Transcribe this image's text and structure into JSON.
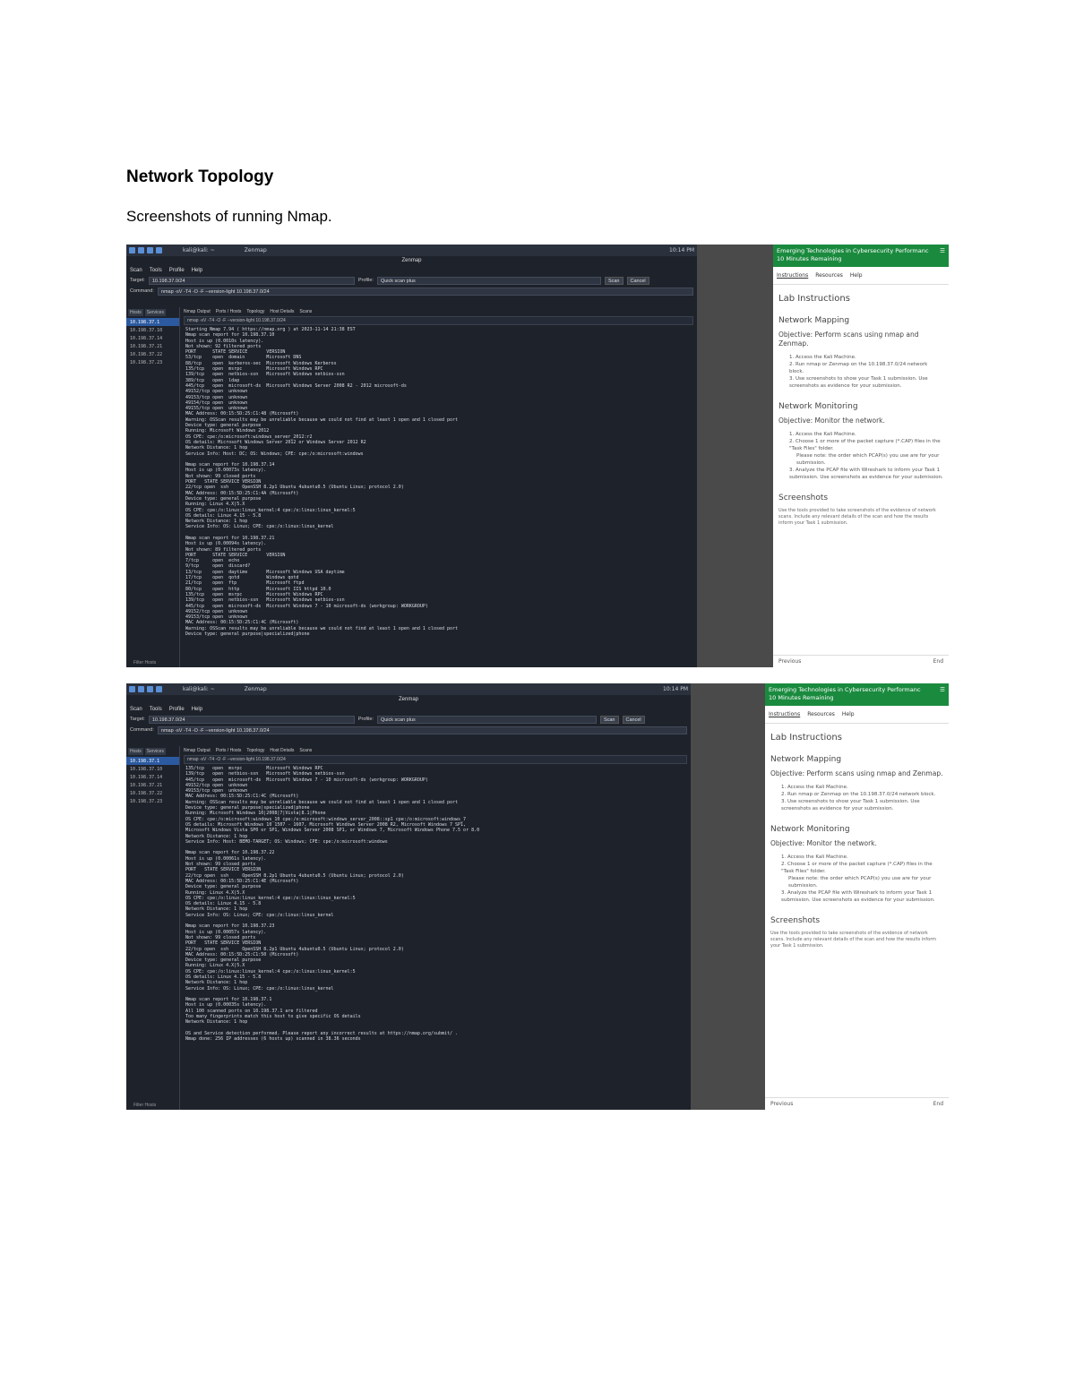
{
  "heading": "Network Topology",
  "caption": "Screenshots of running Nmap.",
  "screens": {
    "taskbar_win1": "kali@kali: ~",
    "taskbar_win2": "Zenmap",
    "clock": "10:14 PM",
    "window_title": "Zenmap",
    "menu": [
      "Scan",
      "Tools",
      "Profile",
      "Help"
    ],
    "target_label": "Target:",
    "target1": "10.198.37.0/24",
    "target2": "10.198.37.0/24",
    "profile_label": "Profile:",
    "profile_value": "Quick scan plus",
    "scan_btn": "Scan",
    "cancel_btn": "Cancel",
    "command_label": "Command:",
    "command": "nmap -sV -T4 -O -F --version-light 10.198.37.0/24",
    "host_tabs": [
      "Hosts",
      "Services"
    ],
    "out_tabs": [
      "Nmap Output",
      "Ports / Hosts",
      "Topology",
      "Host Details",
      "Scans"
    ],
    "out_selector": "nmap -sV -T4 -O -F --version-light 10.198.37.0/24",
    "details_btn": "Details",
    "filter": "Filter Hosts",
    "hosts1": [
      "10.198.37.1",
      "10.198.37.10",
      "10.198.37.14",
      "10.198.37.21",
      "10.198.37.22",
      "10.198.37.23"
    ],
    "hosts2": [
      "10.198.37.1",
      "10.198.37.10",
      "10.198.37.14",
      "10.198.37.21",
      "10.198.37.22",
      "10.198.37.23"
    ],
    "output1": "Starting Nmap 7.94 ( https://nmap.org ) at 2023-11-14 21:38 EST\nNmap scan report for 10.198.37.10\nHost is up (0.0010s latency).\nNot shown: 92 filtered ports\nPORT      STATE SERVICE       VERSION\n53/tcp    open  domain        Microsoft DNS\n88/tcp    open  kerberos-sec  Microsoft Windows Kerberos\n135/tcp   open  msrpc         Microsoft Windows RPC\n139/tcp   open  netbios-ssn   Microsoft Windows netbios-ssn\n389/tcp   open  ldap\n445/tcp   open  microsoft-ds  Microsoft Windows Server 2008 R2 - 2012 microsoft-ds\n49152/tcp open  unknown\n49153/tcp open  unknown\n49154/tcp open  unknown\n49155/tcp open  unknown\nMAC Address: 00:15:5D:25:C1:48 (Microsoft)\nWarning: OSScan results may be unreliable because we could not find at least 1 open and 1 closed port\nDevice type: general purpose\nRunning: Microsoft Windows 2012\nOS CPE: cpe:/o:microsoft:windows_server_2012:r2\nOS details: Microsoft Windows Server 2012 or Windows Server 2012 R2\nNetwork Distance: 1 hop\nService Info: Host: DC; OS: Windows; CPE: cpe:/o:microsoft:windows\n\nNmap scan report for 10.198.37.14\nHost is up (0.00073s latency).\nNot shown: 99 closed ports\nPORT   STATE SERVICE VERSION\n22/tcp open  ssh     OpenSSH 8.2p1 Ubuntu 4ubuntu0.5 (Ubuntu Linux; protocol 2.0)\nMAC Address: 00:15:5D:25:C1:4A (Microsoft)\nDevice type: general purpose\nRunning: Linux 4.X|5.X\nOS CPE: cpe:/o:linux:linux_kernel:4 cpe:/o:linux:linux_kernel:5\nOS details: Linux 4.15 - 5.8\nNetwork Distance: 1 hop\nService Info: OS: Linux; CPE: cpe:/o:linux:linux_kernel\n\nNmap scan report for 10.198.37.21\nHost is up (0.00094s latency).\nNot shown: 89 filtered ports\nPORT      STATE SERVICE       VERSION\n7/tcp     open  echo\n9/tcp     open  discard?\n13/tcp    open  daytime       Microsoft Windows USA daytime\n17/tcp    open  qotd          Windows qotd\n21/tcp    open  ftp           Microsoft ftpd\n80/tcp    open  http          Microsoft IIS httpd 10.0\n135/tcp   open  msrpc         Microsoft Windows RPC\n139/tcp   open  netbios-ssn   Microsoft Windows netbios-ssn\n445/tcp   open  microsoft-ds  Microsoft Windows 7 - 10 microsoft-ds (workgroup: WORKGROUP)\n49152/tcp open  unknown\n49153/tcp open  unknown\nMAC Address: 00:15:5D:25:C1:4C (Microsoft)\nWarning: OSScan results may be unreliable because we could not find at least 1 open and 1 closed port\nDevice type: general purpose|specialized|phone",
    "output2": "135/tcp   open  msrpc         Microsoft Windows RPC\n139/tcp   open  netbios-ssn   Microsoft Windows netbios-ssn\n445/tcp   open  microsoft-ds  Microsoft Windows 7 - 10 microsoft-ds (workgroup: WORKGROUP)\n49152/tcp open  unknown\n49153/tcp open  unknown\nMAC Address: 00:15:5D:25:C1:4C (Microsoft)\nWarning: OSScan results may be unreliable because we could not find at least 1 open and 1 closed port\nDevice type: general purpose|specialized|phone\nRunning: Microsoft Windows 10|2008|7|Vista|8.1|Phone\nOS CPE: cpe:/o:microsoft:windows_10 cpe:/o:microsoft:windows_server_2008::sp1 cpe:/o:microsoft:windows_7\nOS details: Microsoft Windows 10 1507 - 1607, Microsoft Windows Server 2008 R2, Microsoft Windows 7 SP1,\nMicrosoft Windows Vista SP0 or SP1, Windows Server 2008 SP1, or Windows 7, Microsoft Windows Phone 7.5 or 8.0\nNetwork Distance: 1 hop\nService Info: Host: BEMO-TARGET; OS: Windows; CPE: cpe:/o:microsoft:windows\n\nNmap scan report for 10.198.37.22\nHost is up (0.00061s latency).\nNot shown: 99 closed ports\nPORT   STATE SERVICE VERSION\n22/tcp open  ssh     OpenSSH 8.2p1 Ubuntu 4ubuntu0.5 (Ubuntu Linux; protocol 2.0)\nMAC Address: 00:15:5D:25:C1:4E (Microsoft)\nDevice type: general purpose\nRunning: Linux 4.X|5.X\nOS CPE: cpe:/o:linux:linux_kernel:4 cpe:/o:linux:linux_kernel:5\nOS details: Linux 4.15 - 5.8\nNetwork Distance: 1 hop\nService Info: OS: Linux; CPE: cpe:/o:linux:linux_kernel\n\nNmap scan report for 10.198.37.23\nHost is up (0.00057s latency).\nNot shown: 99 closed ports\nPORT   STATE SERVICE VERSION\n22/tcp open  ssh     OpenSSH 8.2p1 Ubuntu 4ubuntu0.5 (Ubuntu Linux; protocol 2.0)\nMAC Address: 00:15:5D:25:C1:50 (Microsoft)\nDevice type: general purpose\nRunning: Linux 4.X|5.X\nOS CPE: cpe:/o:linux:linux_kernel:4 cpe:/o:linux:linux_kernel:5\nOS details: Linux 4.15 - 5.8\nNetwork Distance: 1 hop\nService Info: OS: Linux; CPE: cpe:/o:linux:linux_kernel\n\nNmap scan report for 10.198.37.1\nHost is up (0.00035s latency).\nAll 100 scanned ports on 10.198.37.1 are filtered\nToo many fingerprints match this host to give specific OS details\nNetwork Distance: 1 hop\n\nOS and Service detection performed. Please report any incorrect results at https://nmap.org/submit/ .\nNmap done: 256 IP addresses (6 hosts up) scanned in 38.36 seconds",
    "lab": {
      "header": "Emerging Technologies in Cybersecurity Performance Assessment",
      "header_sub": "10 Minutes Remaining",
      "tabs": [
        "Instructions",
        "Resources",
        "Help"
      ],
      "title": "Lab Instructions",
      "sec1": "Network Mapping",
      "obj1": "Objective: Perform scans using nmap and Zenmap.",
      "list1": [
        "1. Access the Kali Machine.",
        "2. Run nmap or Zenmap on the 10.198.37.0/24 network block.",
        "3. Use screenshots to show your Task 1 submission. Use screenshots as evidence for your submission."
      ],
      "sec2": "Network Monitoring",
      "obj2": "Objective: Monitor the network.",
      "list2": [
        "1. Access the Kali Machine.",
        "2. Choose 1 or more of the packet capture (*.CAP) files in the \"Task Files\" folder.",
        "Please note: the order which PCAP(s) you use are for your submission.",
        "3. Analyze the PCAP file with Wireshark to inform your Task 1 submission. Use screenshots as evidence for your submission."
      ],
      "sec3": "Screenshots",
      "para": "Use the tools provided to take screenshots of the evidence of network scans. Include any relevant details of the scan and how the results inform your Task 1 submission.",
      "prev": "Previous",
      "end": "End"
    }
  }
}
